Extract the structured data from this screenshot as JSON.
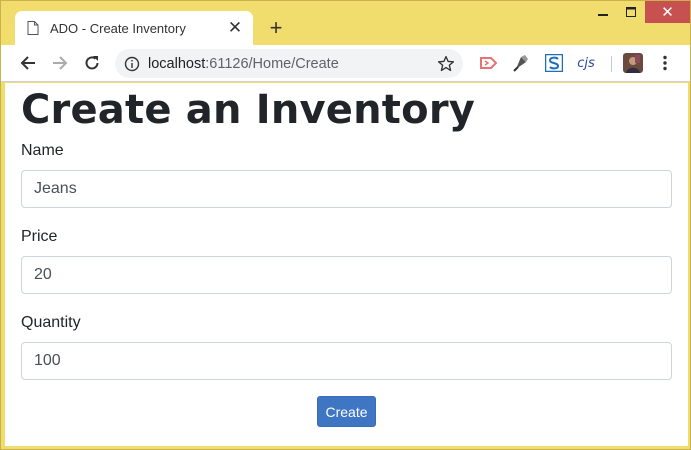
{
  "browser": {
    "tab_title": "ADO - Create Inventory",
    "tab_close": "✕",
    "new_tab": "+",
    "url_host": "localhost",
    "url_path": ":61126/Home/Create",
    "close_glyph": "✕"
  },
  "extensions": [
    "pocket-icon",
    "paint-icon",
    "s-extension-icon",
    "cjs-extension-icon"
  ],
  "ext_cjs_label": "cjs",
  "page": {
    "heading": "Create an Inventory",
    "fields": [
      {
        "label": "Name",
        "value": "Jeans"
      },
      {
        "label": "Price",
        "value": "20"
      },
      {
        "label": "Quantity",
        "value": "100"
      }
    ],
    "submit_label": "Create"
  },
  "colors": {
    "frame": "#f1dc6e",
    "button": "#3e76c3",
    "close": "#c75050"
  }
}
